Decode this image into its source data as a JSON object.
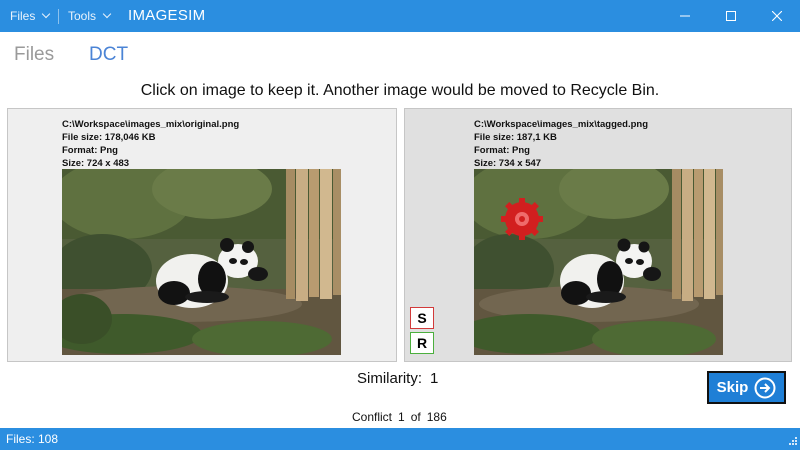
{
  "titlebar": {
    "menu_files": "Files",
    "menu_tools": "Tools",
    "app_title": "IMAGESIM"
  },
  "tabs": [
    {
      "label": "Files"
    },
    {
      "label": "DCT"
    }
  ],
  "instruction": "Click on image to keep it. Another image would be moved to Recycle Bin.",
  "left_image": {
    "path": "C:\\Workspace\\images_mix\\original.png",
    "file_size": "File size: 178,046 KB",
    "format": "Format: Png",
    "size": "Size:  724 x 483"
  },
  "right_image": {
    "path": "C:\\Workspace\\images_mix\\tagged.png",
    "file_size": "File size: 187,1 KB",
    "format": "Format: Png",
    "size": "Size:  734 x 547"
  },
  "buttons": {
    "s_label": "S",
    "r_label": "R",
    "skip_label": "Skip"
  },
  "similarity": {
    "label": "Similarity:",
    "value": "1"
  },
  "conflict": {
    "label": "Conflict",
    "current": "1",
    "of": "of",
    "total": "186"
  },
  "status": {
    "text": "Files: 108"
  },
  "colors": {
    "accent": "#2b8ee0",
    "tab_active": "#4b84d6",
    "tab_inactive": "#9a9a9a",
    "s_border": "#d23a3a",
    "r_border": "#4caf3e",
    "skip_bg": "#1f7fd6"
  },
  "icons": {
    "minimize": "minimize-icon",
    "maximize": "maximize-icon",
    "close": "close-icon",
    "skip": "arrow-right-circle-icon",
    "resize": "resize-grip-icon"
  }
}
